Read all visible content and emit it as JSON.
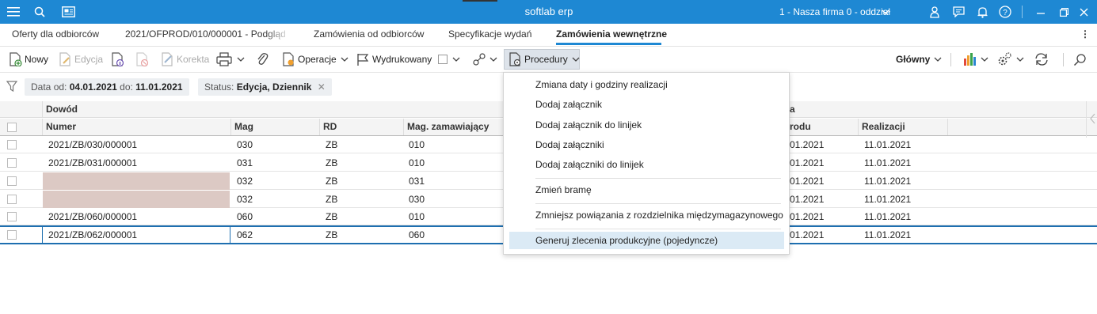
{
  "app": {
    "title": "softlab erp",
    "company": "1 - Nasza firma 0 - oddział",
    "accent": "#1e88d3"
  },
  "titlebar_icons": [
    "hamburger-icon",
    "search-icon",
    "news-icon",
    "chevron-down-icon",
    "user-icon",
    "chat-icon",
    "bell-icon",
    "help-icon",
    "minimize-icon",
    "restore-icon",
    "close-icon"
  ],
  "tabs": [
    {
      "label": "Oferty dla odbiorców"
    },
    {
      "label": "2021/OFPROD/010/000001 - Podgląd"
    },
    {
      "label": "Zamówienia od odbiorców"
    },
    {
      "label": "Specyfikacje wydań"
    },
    {
      "label": "Zamówienia wewnętrzne",
      "active": true
    }
  ],
  "toolbar": {
    "new": "Nowy",
    "edit": "Edycja",
    "correction": "Korekta",
    "operations": "Operacje",
    "printed": "Wydrukowany",
    "procedures": "Procedury",
    "view": "Główny"
  },
  "filters": {
    "date_label": "Data",
    "from_label": "od:",
    "from_value": "04.01.2021",
    "to_label": "do:",
    "to_value": "11.01.2021",
    "status_label": "Status:",
    "status_value": "Edycja, Dziennik"
  },
  "grid": {
    "group_header": "Dowód",
    "group_header2": "a",
    "columns": [
      "Numer",
      "Mag",
      "RD",
      "Mag. zamawiający",
      "rodu",
      "Realizacji"
    ],
    "rows": [
      {
        "numer": "2021/ZB/030/000001",
        "mag": "030",
        "rd": "ZB",
        "magz": "010",
        "d1": "01.2021",
        "d2": "11.01.2021"
      },
      {
        "numer": "2021/ZB/031/000001",
        "mag": "031",
        "rd": "ZB",
        "magz": "010",
        "d1": "01.2021",
        "d2": "11.01.2021"
      },
      {
        "numer": "",
        "mag": "032",
        "rd": "ZB",
        "magz": "031",
        "d1": "01.2021",
        "d2": "11.01.2021",
        "redacted": true
      },
      {
        "numer": "",
        "mag": "032",
        "rd": "ZB",
        "magz": "030",
        "d1": "01.2021",
        "d2": "11.01.2021",
        "redacted": true
      },
      {
        "numer": "2021/ZB/060/000001",
        "mag": "060",
        "rd": "ZB",
        "magz": "010",
        "d1": "01.2021",
        "d2": "11.01.2021"
      },
      {
        "numer": "2021/ZB/062/000001",
        "mag": "062",
        "rd": "ZB",
        "magz": "060",
        "d1": "01.2021",
        "d2": "11.01.2021",
        "selected": true
      }
    ]
  },
  "menu": {
    "items": [
      "Zmiana daty i godziny realizacji",
      "Dodaj załącznik",
      "Dodaj załącznik do linijek",
      "Dodaj załączniki",
      "Dodaj załączniki do linijek",
      "Zmień bramę",
      "Zmniejsz powiązania z rozdzielnika międzymagazynowego",
      "Generuj zlecenia produkcyjne (pojedyncze)"
    ]
  }
}
